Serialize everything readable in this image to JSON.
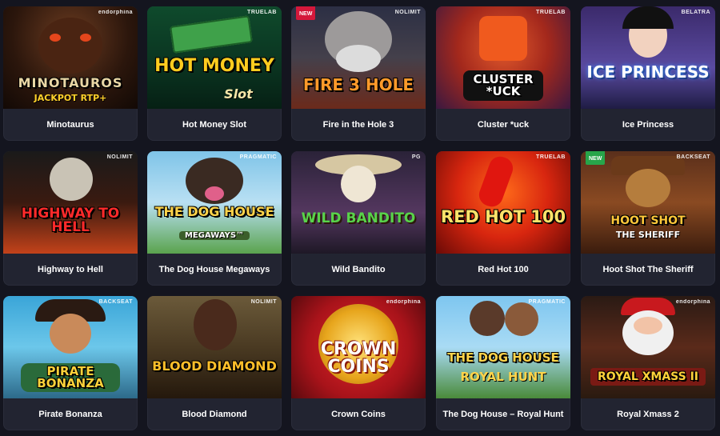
{
  "games": [
    {
      "title": "Minotaurus",
      "art": "MINOTAUROS",
      "art_sub": "JACKPOT RTP+",
      "provider": "endorphina",
      "badge": ""
    },
    {
      "title": "Hot Money Slot",
      "art": "HOT MONEY",
      "art_sub": "Slot",
      "provider": "TRUELAB",
      "badge": ""
    },
    {
      "title": "Fire in the Hole 3",
      "art": "FIRE 3 HOLE",
      "art_sub": "",
      "provider": "NOLIMIT",
      "badge": "NEW"
    },
    {
      "title": "Cluster *uck",
      "art": "CLUSTER *UCK",
      "art_sub": "",
      "provider": "TRUELAB",
      "badge": ""
    },
    {
      "title": "Ice Princess",
      "art": "ICE PRINCESS",
      "art_sub": "",
      "provider": "BELATRA",
      "badge": ""
    },
    {
      "title": "Highway to Hell",
      "art": "HIGHWAY TO HELL",
      "art_sub": "",
      "provider": "NOLIMIT",
      "badge": ""
    },
    {
      "title": "The Dog House Megaways",
      "art": "THE DOG HOUSE",
      "art_sub": "MEGAWAYS™",
      "provider": "PRAGMATIC",
      "badge": ""
    },
    {
      "title": "Wild Bandito",
      "art": "WILD BANDITO",
      "art_sub": "",
      "provider": "PG",
      "badge": ""
    },
    {
      "title": "Red Hot 100",
      "art": "RED HOT 100",
      "art_sub": "",
      "provider": "TRUELAB",
      "badge": ""
    },
    {
      "title": "Hoot Shot The Sheriff",
      "art": "HOOT SHOT",
      "art_sub": "THE SHERIFF",
      "provider": "BACKSEAT",
      "badge": "NEW"
    },
    {
      "title": "Pirate Bonanza",
      "art": "PIRATE BONANZA",
      "art_sub": "",
      "provider": "BACKSEAT",
      "badge": ""
    },
    {
      "title": "Blood Diamond",
      "art": "BLOOD DIAMOND",
      "art_sub": "",
      "provider": "NOLIMIT",
      "badge": ""
    },
    {
      "title": "Crown Coins",
      "art": "CROWN COINS",
      "art_sub": "",
      "provider": "endorphina",
      "badge": ""
    },
    {
      "title": "The Dog House – Royal Hunt",
      "art": "THE DOG HOUSE",
      "art_sub": "ROYAL HUNT",
      "provider": "PRAGMATIC",
      "badge": ""
    },
    {
      "title": "Royal Xmass 2",
      "art": "ROYAL XMASS II",
      "art_sub": "",
      "provider": "endorphina",
      "badge": ""
    }
  ],
  "colors": {
    "background": "#14151f",
    "card": "#222431",
    "label_text": "#ffffff",
    "new_badge_red": "#d4183b",
    "new_badge_green": "#27a54a"
  }
}
